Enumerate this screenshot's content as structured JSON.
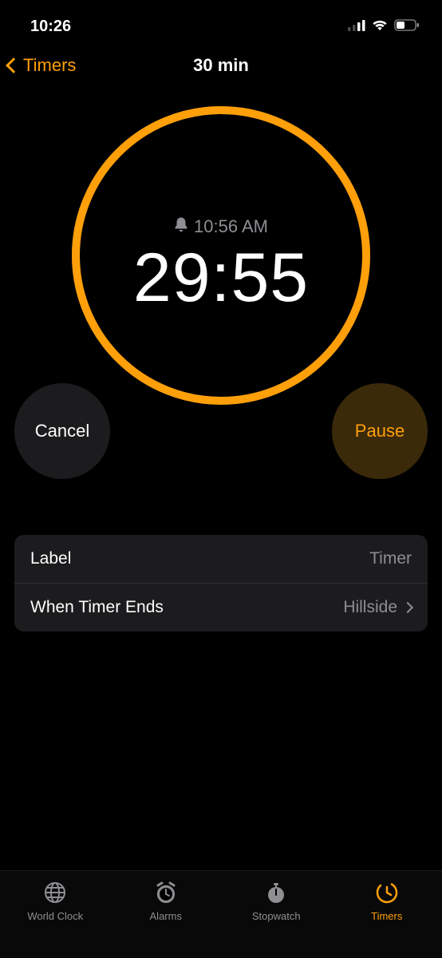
{
  "statusbar": {
    "time": "10:26"
  },
  "navbar": {
    "back_label": "Timers",
    "title": "30 min"
  },
  "timer": {
    "end_time": "10:56 AM",
    "countdown": "29:55",
    "progress_fraction": 0.997
  },
  "buttons": {
    "cancel_label": "Cancel",
    "pause_label": "Pause"
  },
  "rows": {
    "label_title": "Label",
    "label_value": "Timer",
    "ends_title": "When Timer Ends",
    "ends_value": "Hillside"
  },
  "tabs": {
    "world_clock": "World Clock",
    "alarms": "Alarms",
    "stopwatch": "Stopwatch",
    "timers": "Timers"
  },
  "colors": {
    "accent": "#ff9f0a"
  }
}
